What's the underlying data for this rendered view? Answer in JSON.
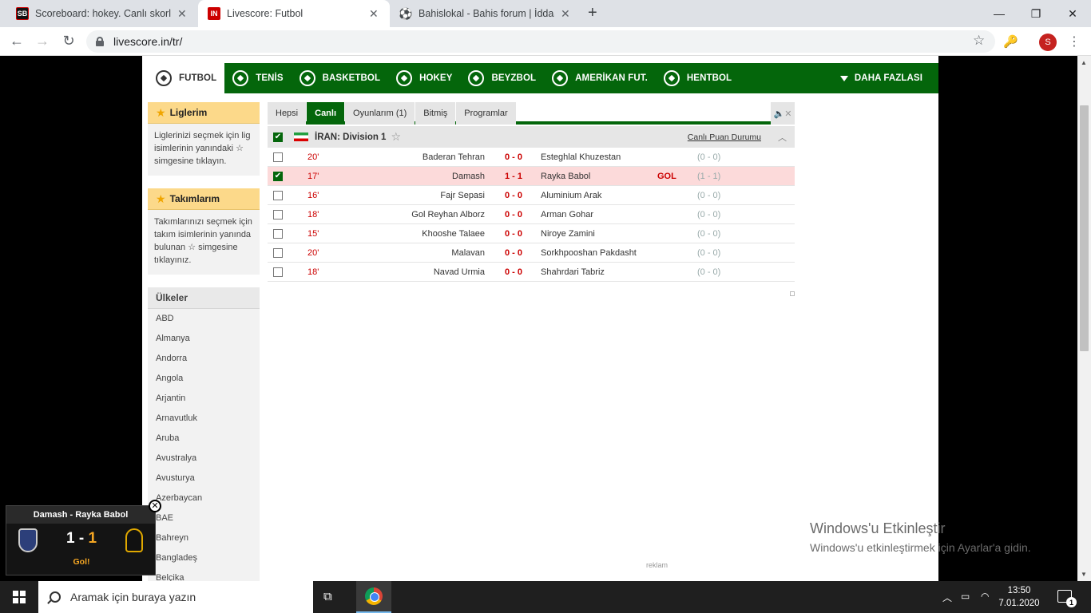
{
  "browser": {
    "tabs": [
      {
        "title": "Scoreboard: hokey. Canlı skorlar,",
        "favicon": "SB"
      },
      {
        "title": "Livescore: Futbol",
        "favicon": "IN"
      },
      {
        "title": "Bahislokal - Bahis forum | İddaa t",
        "favicon": "ball-icon"
      }
    ],
    "url": "livescore.in/tr/",
    "avatar_letter": "S"
  },
  "sports_nav": {
    "items": [
      "FUTBOL",
      "TENİS",
      "BASKETBOL",
      "HOKEY",
      "BEYZBOL",
      "AMERİKAN FUT.",
      "HENTBOL"
    ],
    "more_label": "DAHA FAZLASI"
  },
  "sidebar": {
    "my_leagues_title": "Liglerim",
    "my_leagues_text": "Liglerinizi seçmek için lig isimlerinin yanındaki ☆ simgesine tıklayın.",
    "my_teams_title": "Takımlarım",
    "my_teams_text": "Takımlarınızı seçmek için takım isimlerinin yanında bulunan ☆ simgesine tıklayınız.",
    "countries_title": "Ülkeler",
    "countries": [
      "ABD",
      "Almanya",
      "Andorra",
      "Angola",
      "Arjantin",
      "Arnavutluk",
      "Aruba",
      "Avustralya",
      "Avusturya",
      "Azerbaycan",
      "BAE",
      "Bahreyn",
      "Bangladeş",
      "Belçika"
    ]
  },
  "main": {
    "tabs": [
      "Hepsi",
      "Canlı",
      "Oyunlarım (1)",
      "Bitmiş",
      "Programlar"
    ],
    "active_tab": "Canlı",
    "league": {
      "name": "İRAN: Division 1",
      "standings_link": "Canlı Puan Durumu"
    },
    "matches": [
      {
        "minute": "20'",
        "home": "Baderan Tehran",
        "score": "0 - 0",
        "away": "Esteghlal Khuzestan",
        "goal": "",
        "ht": "(0 - 0)",
        "checked": false,
        "highlight": false
      },
      {
        "minute": "17'",
        "home": "Damash",
        "score": "1 - 1",
        "away": "Rayka Babol",
        "goal": "GOL",
        "ht": "(1 - 1)",
        "checked": true,
        "highlight": true
      },
      {
        "minute": "16'",
        "home": "Fajr Sepasi",
        "score": "0 - 0",
        "away": "Aluminium Arak",
        "goal": "",
        "ht": "(0 - 0)",
        "checked": false,
        "highlight": false
      },
      {
        "minute": "18'",
        "home": "Gol Reyhan Alborz",
        "score": "0 - 0",
        "away": "Arman Gohar",
        "goal": "",
        "ht": "(0 - 0)",
        "checked": false,
        "highlight": false
      },
      {
        "minute": "15'",
        "home": "Khooshe Talaee",
        "score": "0 - 0",
        "away": "Niroye Zamini",
        "goal": "",
        "ht": "(0 - 0)",
        "checked": false,
        "highlight": false
      },
      {
        "minute": "20'",
        "home": "Malavan",
        "score": "0 - 0",
        "away": "Sorkhpooshan Pakdasht",
        "goal": "",
        "ht": "(0 - 0)",
        "checked": false,
        "highlight": false
      },
      {
        "minute": "18'",
        "home": "Navad Urmia",
        "score": "0 - 0",
        "away": "Shahrdari Tabriz",
        "goal": "",
        "ht": "(0 - 0)",
        "checked": false,
        "highlight": false
      }
    ],
    "ad_label": "reklam"
  },
  "popup": {
    "title": "Damash - Rayka Babol",
    "home_score": "1",
    "sep": "-",
    "away_score": "1",
    "status": "Gol!"
  },
  "watermark": {
    "title": "Windows'u Etkinleştir",
    "subtitle": "Windows'u etkinleştirmek için Ayarlar'a gidin."
  },
  "taskbar": {
    "search_placeholder": "Aramak için buraya yazın",
    "time": "13:50",
    "date": "7.01.2020",
    "notifications": "1"
  },
  "colors": {
    "brand_green": "#04660b",
    "league_box": "#fcd98a",
    "live_red": "#cc0000",
    "goal_row": "#fcdada"
  }
}
